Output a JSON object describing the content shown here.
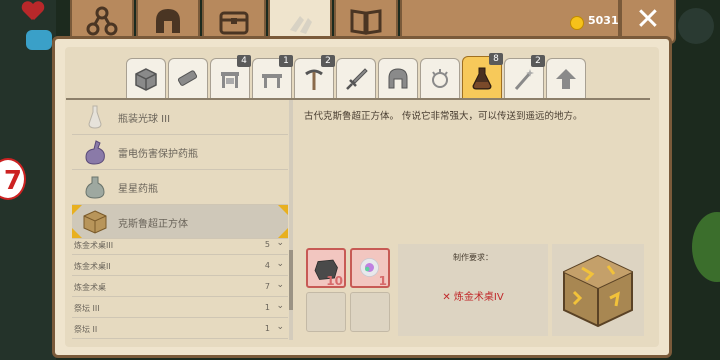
{
  "currency": {
    "coin_icon": "coin-icon",
    "amount": "5031"
  },
  "close_label": "✕",
  "top_tabs": [
    {
      "icon": "crafting-network-icon"
    },
    {
      "icon": "helmet-icon"
    },
    {
      "icon": "chest-icon"
    },
    {
      "icon": "crafting-hands-icon",
      "active": true
    },
    {
      "icon": "book-icon"
    }
  ],
  "category_tabs": [
    {
      "icon": "block-icon",
      "badge": ""
    },
    {
      "icon": "materials-icon",
      "badge": ""
    },
    {
      "icon": "furniture-icon",
      "badge": "4"
    },
    {
      "icon": "table-icon",
      "badge": "1"
    },
    {
      "icon": "pickaxe-icon",
      "badge": "2"
    },
    {
      "icon": "sword-icon",
      "badge": ""
    },
    {
      "icon": "armor-helmet-icon",
      "badge": ""
    },
    {
      "icon": "sparkle-icon",
      "badge": ""
    },
    {
      "icon": "potion-flask-icon",
      "badge": "8",
      "active": true
    },
    {
      "icon": "magic-wand-icon",
      "badge": "2"
    },
    {
      "icon": "upgrade-arrow-icon",
      "badge": ""
    }
  ],
  "recipes": [
    {
      "label": "瓶装光球 III"
    },
    {
      "label": "雷电伤害保护药瓶"
    },
    {
      "label": "星星药瓶"
    },
    {
      "label": "克斯鲁超正方体",
      "selected": true
    }
  ],
  "categories": [
    {
      "label": "炼金术桌III",
      "count": "5"
    },
    {
      "label": "炼金术桌II",
      "count": "4"
    },
    {
      "label": "炼金术桌",
      "count": "7"
    },
    {
      "label": "祭坛 III",
      "count": "1"
    },
    {
      "label": "祭坛 II",
      "count": "1"
    }
  ],
  "detail": {
    "description": "古代克斯鲁超正方体。 传说它非常强大，可以传送到遥远的地方。",
    "ingredients": [
      {
        "icon": "dark-stone-icon",
        "qty": "10"
      },
      {
        "icon": "rainbow-orb-icon",
        "qty": "1"
      }
    ],
    "requirement_title": "制作要求：",
    "requirement_item": "✕ 炼金术桌IV",
    "preview_icon": "tesseract-cube-icon"
  }
}
